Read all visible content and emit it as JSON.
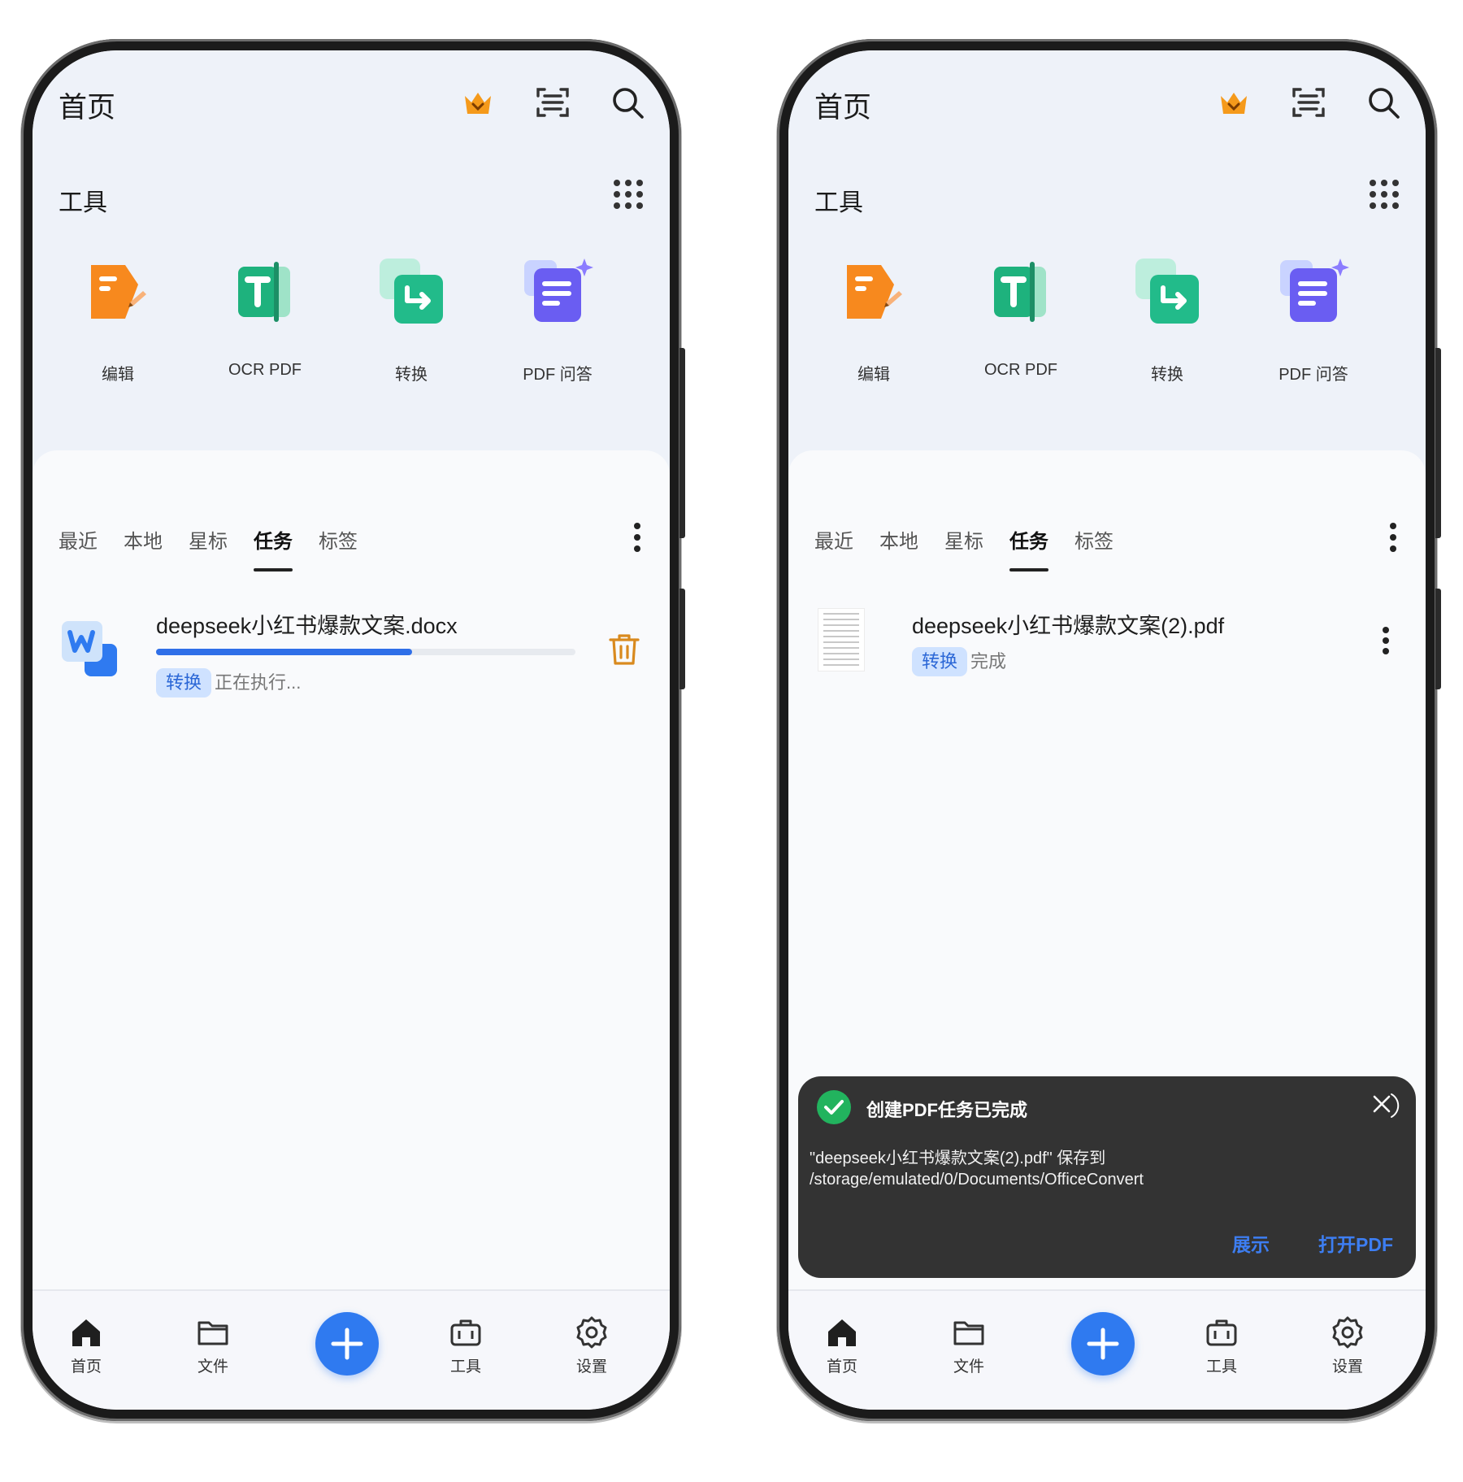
{
  "screens": [
    {
      "header": {
        "title": "首页"
      },
      "tools": {
        "title": "工具",
        "items": [
          {
            "label": "编辑"
          },
          {
            "label": "OCR PDF"
          },
          {
            "label": "转换"
          },
          {
            "label": "PDF 问答"
          }
        ]
      },
      "tabs": [
        "最近",
        "本地",
        "星标",
        "任务",
        "标签"
      ],
      "active_tab": "任务",
      "task": {
        "file_name": "deepseek小红书爆款文案.docx",
        "tag": "转换",
        "status": "正在执行...",
        "progress": 0.61
      },
      "nav": [
        "首页",
        "文件",
        "工具",
        "设置"
      ]
    },
    {
      "header": {
        "title": "首页"
      },
      "tools": {
        "title": "工具",
        "items": [
          {
            "label": "编辑"
          },
          {
            "label": "OCR PDF"
          },
          {
            "label": "转换"
          },
          {
            "label": "PDF 问答"
          }
        ]
      },
      "tabs": [
        "最近",
        "本地",
        "星标",
        "任务",
        "标签"
      ],
      "active_tab": "任务",
      "task": {
        "file_name": "deepseek小红书爆款文案(2).pdf",
        "tag": "转换",
        "status": "完成"
      },
      "toast": {
        "title": "创建PDF任务已完成",
        "message": "\"deepseek小红书爆款文案(2).pdf\" 保存到 /storage/emulated/0/Documents/OfficeConvert",
        "show_button": "展示",
        "open_button": "打开PDF"
      },
      "nav": [
        "首页",
        "文件",
        "工具",
        "设置"
      ]
    }
  ],
  "colors": {
    "accent": "#2f7af0",
    "tag_bg": "#cfe2ff",
    "tag_text": "#2b67d6",
    "crown": "#f59a1b",
    "toast_bg": "#333333",
    "success": "#22b35e"
  },
  "icons": [
    "crown-icon",
    "scan-icon",
    "search-icon",
    "grid-icon",
    "edit-tool-icon",
    "ocr-tool-icon",
    "convert-tool-icon",
    "pdf-qa-tool-icon",
    "more-icon",
    "word-file-icon",
    "trash-icon",
    "home-icon",
    "folder-icon",
    "plus-icon",
    "toolbox-icon",
    "gear-icon",
    "check-circle-icon",
    "close-icon"
  ]
}
